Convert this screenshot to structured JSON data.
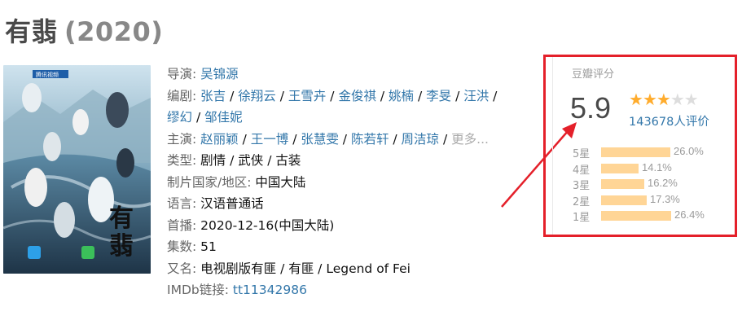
{
  "header": {
    "title": "有翡",
    "year": "(2020)"
  },
  "poster": {
    "title_glyphs": [
      "有",
      "翡"
    ],
    "logo_text": "腾讯视频"
  },
  "info": {
    "director_label": "导演:",
    "director": "吴锦源",
    "writers_label": "编剧:",
    "writers": [
      "张吉",
      "徐翔云",
      "王雪卉",
      "金俊祺",
      "姚楠",
      "李旻",
      "汪洪",
      "缪幻",
      "邹佳妮"
    ],
    "cast_label": "主演:",
    "cast": [
      "赵丽颖",
      "王一博",
      "张慧雯",
      "陈若轩",
      "周洁琼"
    ],
    "cast_more": "更多...",
    "genre_label": "类型:",
    "genres": [
      "剧情",
      "武侠",
      "古装"
    ],
    "country_label": "制片国家/地区:",
    "country": "中国大陆",
    "language_label": "语言:",
    "language": "汉语普通话",
    "premiere_label": "首播:",
    "premiere": "2020-12-16(中国大陆)",
    "episodes_label": "集数:",
    "episodes": "51",
    "aka_label": "又名:",
    "aka": "电视剧版有匪 / 有匪 / Legend of Fei",
    "imdb_label": "IMDb链接:",
    "imdb": "tt11342986"
  },
  "rating": {
    "title": "豆瓣评分",
    "score": "5.9",
    "stars_filled": 3,
    "stars_total": 5,
    "votes": "143678人评价",
    "distribution": [
      {
        "label": "5星",
        "percent": "26.0%",
        "value": 26.0
      },
      {
        "label": "4星",
        "percent": "14.1%",
        "value": 14.1
      },
      {
        "label": "3星",
        "percent": "16.2%",
        "value": 16.2
      },
      {
        "label": "2星",
        "percent": "17.3%",
        "value": 17.3
      },
      {
        "label": "1星",
        "percent": "26.4%",
        "value": 26.4
      }
    ]
  },
  "colors": {
    "link": "#3377aa",
    "star": "#ffac2d",
    "bar": "#ffd596",
    "highlight": "#e4202a"
  }
}
